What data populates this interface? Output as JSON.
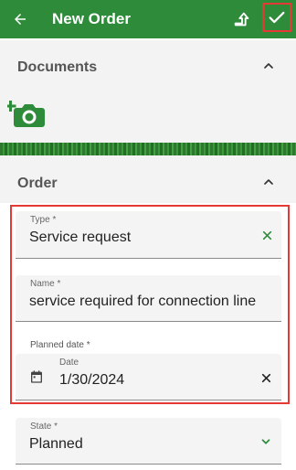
{
  "appbar": {
    "title": "New Order",
    "back_icon": "arrow-back-icon",
    "upload_icon": "upload-icon",
    "confirm_icon": "check-icon"
  },
  "sections": {
    "documents": {
      "title": "Documents"
    },
    "order": {
      "title": "Order"
    }
  },
  "fields": {
    "type": {
      "label": "Type *",
      "value": "Service request"
    },
    "name": {
      "label": "Name *",
      "value": "service required for connection line"
    },
    "planned_date": {
      "label": "Planned date *",
      "sublabel": "Date",
      "value": "1/30/2024"
    },
    "state": {
      "label": "State *",
      "value": "Planned"
    }
  },
  "colors": {
    "accent": "#2e8b3a",
    "highlight": "#e53935"
  }
}
